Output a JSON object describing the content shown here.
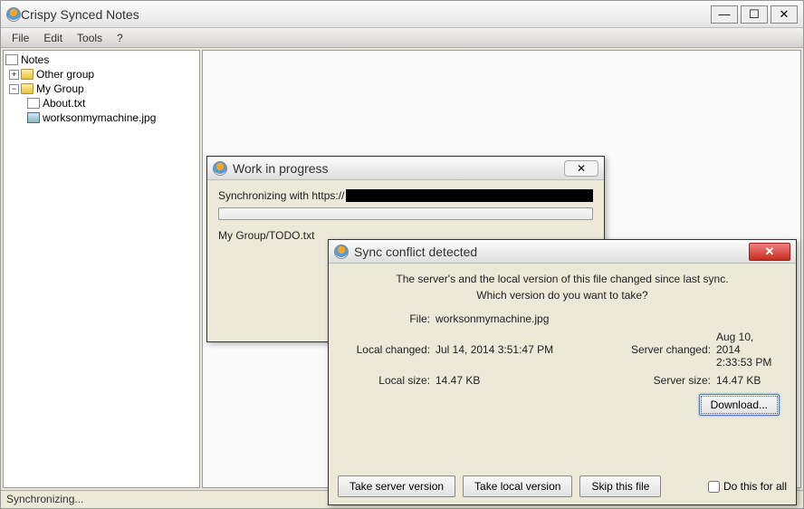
{
  "main": {
    "title": "Crispy Synced Notes",
    "menu": {
      "file": "File",
      "edit": "Edit",
      "tools": "Tools",
      "help": "?"
    },
    "tree": {
      "root": "Notes",
      "group1": "Other group",
      "group2": "My Group",
      "file1": "About.txt",
      "file2": "worksonmymachine.jpg"
    },
    "status": "Synchronizing..."
  },
  "progress": {
    "title": "Work in progress",
    "sync_prefix": "Synchronizing with https://",
    "current_file": "My Group/TODO.txt"
  },
  "conflict": {
    "title": "Sync conflict detected",
    "msg_line1": "The server's and the local version of this file changed since last sync.",
    "msg_line2": "Which version do you want to take?",
    "file_lbl": "File:",
    "file_val": "worksonmymachine.jpg",
    "local_changed_lbl": "Local changed:",
    "local_changed_val": "Jul 14, 2014 3:51:47 PM",
    "server_changed_lbl": "Server changed:",
    "server_changed_val": "Aug 10, 2014 2:33:53 PM",
    "local_size_lbl": "Local size:",
    "local_size_val": "14.47 KB",
    "server_size_lbl": "Server size:",
    "server_size_val": "14.47 KB",
    "download_btn": "Download...",
    "take_server_btn": "Take server version",
    "take_local_btn": "Take local version",
    "skip_btn": "Skip this file",
    "do_all_lbl": "Do this for all"
  }
}
